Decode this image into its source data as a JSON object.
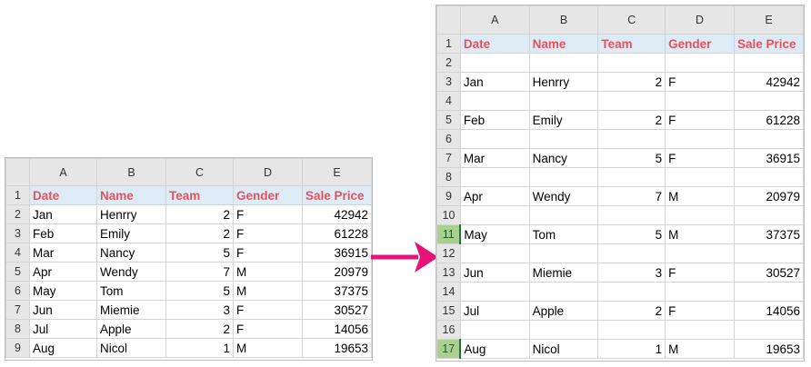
{
  "columns": [
    "A",
    "B",
    "C",
    "D",
    "E"
  ],
  "header": [
    "Date",
    "Name",
    "Team",
    "Gender",
    "Sale Price"
  ],
  "records": [
    [
      "Jan",
      "Henrry",
      "2",
      "F",
      "42942"
    ],
    [
      "Feb",
      "Emily",
      "2",
      "F",
      "61228"
    ],
    [
      "Mar",
      "Nancy",
      "5",
      "F",
      "36915"
    ],
    [
      "Apr",
      "Wendy",
      "7",
      "M",
      "20979"
    ],
    [
      "May",
      "Tom",
      "5",
      "M",
      "37375"
    ],
    [
      "Jun",
      "Miemie",
      "3",
      "F",
      "30527"
    ],
    [
      "Jul",
      "Apple",
      "2",
      "F",
      "14056"
    ],
    [
      "Aug",
      "Nicol",
      "1",
      "M",
      "19653"
    ]
  ],
  "before_row_numbers": [
    "1",
    "2",
    "3",
    "4",
    "5",
    "6",
    "7",
    "8",
    "9"
  ],
  "after_row_numbers": [
    "1",
    "2",
    "3",
    "4",
    "5",
    "6",
    "7",
    "8",
    "9",
    "10",
    "11",
    "12",
    "13",
    "14",
    "15",
    "16",
    "17"
  ],
  "after_selected_rows": [
    "11",
    "17"
  ],
  "colors": {
    "header_text": "#e8515c",
    "header_fill": "#ddebf7",
    "arrow": "#e6127a",
    "selected_row_header": "#a9d08e"
  }
}
